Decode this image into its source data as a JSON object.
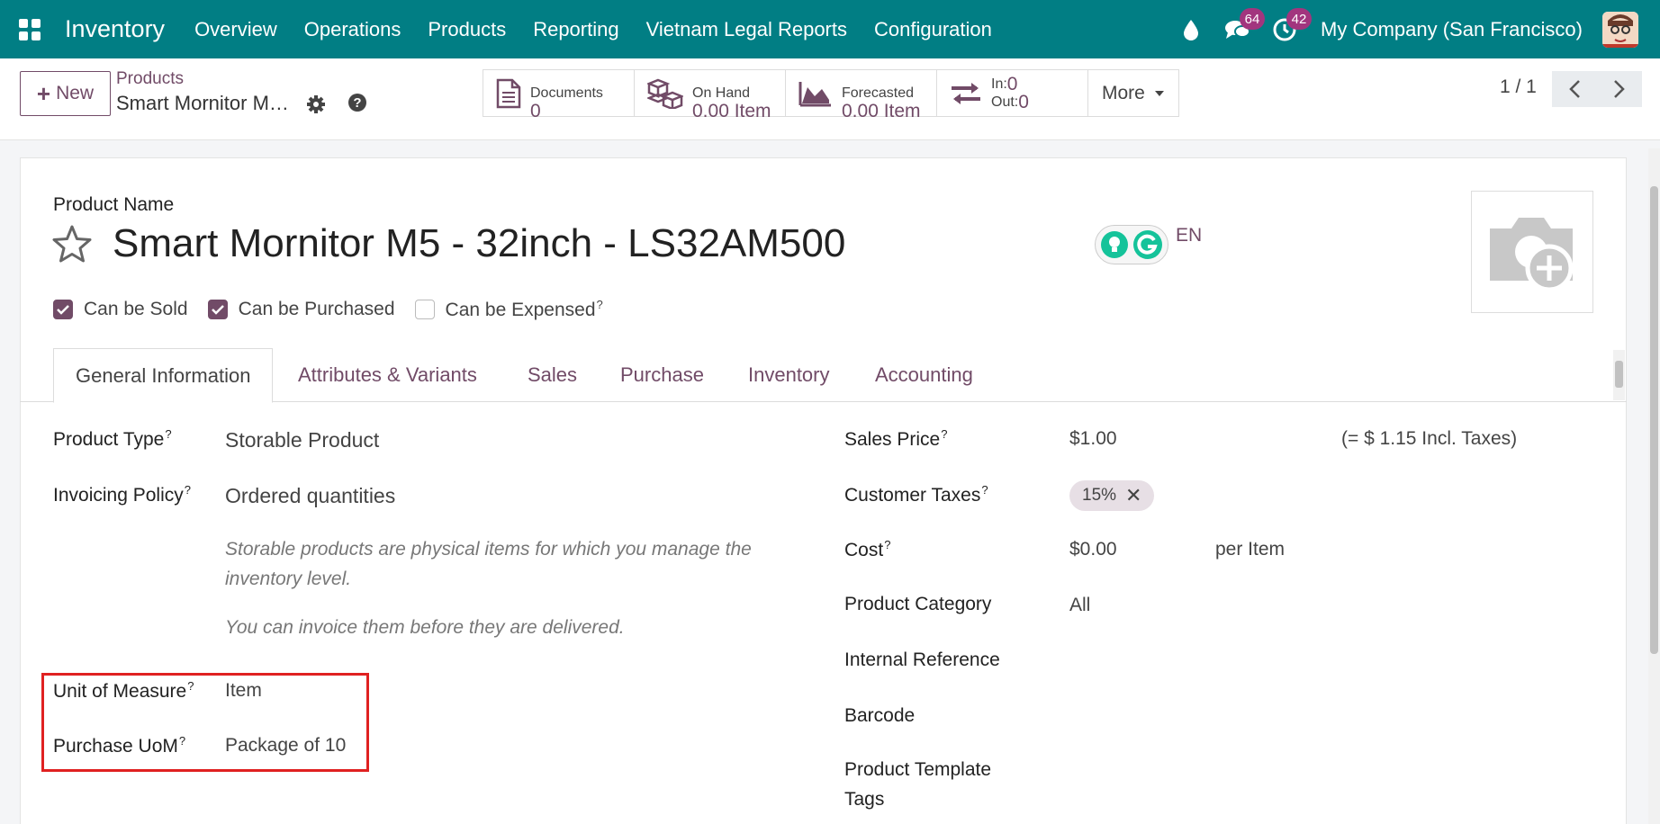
{
  "topnav": {
    "brand": "Inventory",
    "menu": [
      "Overview",
      "Operations",
      "Products",
      "Reporting",
      "Vietnam Legal Reports",
      "Configuration"
    ],
    "messages_count": "64",
    "activities_count": "42",
    "company": "My Company (San Francisco)",
    "bg_color": "#017e84"
  },
  "control": {
    "new_label": "New",
    "breadcrumb_parent": "Products",
    "breadcrumb_current": "Smart Mornitor M5 - 32inch - LS32AM500",
    "smart_buttons": [
      {
        "label": "Documents",
        "value": "0"
      },
      {
        "label": "On Hand",
        "value": "0.00 Item"
      },
      {
        "label": "Forecasted",
        "value": "0.00 Item"
      },
      {
        "label_in": "In:",
        "value_in": "0",
        "label_out": "Out:",
        "value_out": "0"
      }
    ],
    "more_label": "More",
    "pager": "1 / 1"
  },
  "form": {
    "name_label": "Product Name",
    "product_name": "Smart Mornitor M5 - 32inch - LS32AM500",
    "lang": "EN",
    "checkboxes": [
      {
        "label": "Can be Sold",
        "checked": true
      },
      {
        "label": "Can be Purchased",
        "checked": true
      },
      {
        "label": "Can be Expensed",
        "checked": false
      }
    ],
    "tabs": [
      "General Information",
      "Attributes & Variants",
      "Sales",
      "Purchase",
      "Inventory",
      "Accounting"
    ],
    "left": {
      "product_type_label": "Product Type",
      "product_type": "Storable Product",
      "invoicing_policy_label": "Invoicing Policy",
      "invoicing_policy": "Ordered quantities",
      "help_1": "Storable products are physical items for which you manage the inventory level.",
      "help_2": "You can invoice them before they are delivered.",
      "uom_label": "Unit of Measure",
      "uom": "Item",
      "purchase_uom_label": "Purchase UoM",
      "purchase_uom": "Package of 10"
    },
    "right": {
      "sales_price_label": "Sales Price",
      "sales_price": "$1.00",
      "incl_taxes": "(= $ 1.15 Incl. Taxes)",
      "customer_taxes_label": "Customer Taxes",
      "customer_tax_tag": "15%",
      "cost_label": "Cost",
      "cost": "$0.00",
      "cost_unit": "per Item",
      "category_label": "Product Category",
      "category": "All",
      "internal_ref_label": "Internal Reference",
      "barcode_label": "Barcode",
      "tags_label_1": "Product Template",
      "tags_label_2": "Tags"
    }
  },
  "colors": {
    "accent": "#714b67",
    "highlight": "#e02121"
  }
}
